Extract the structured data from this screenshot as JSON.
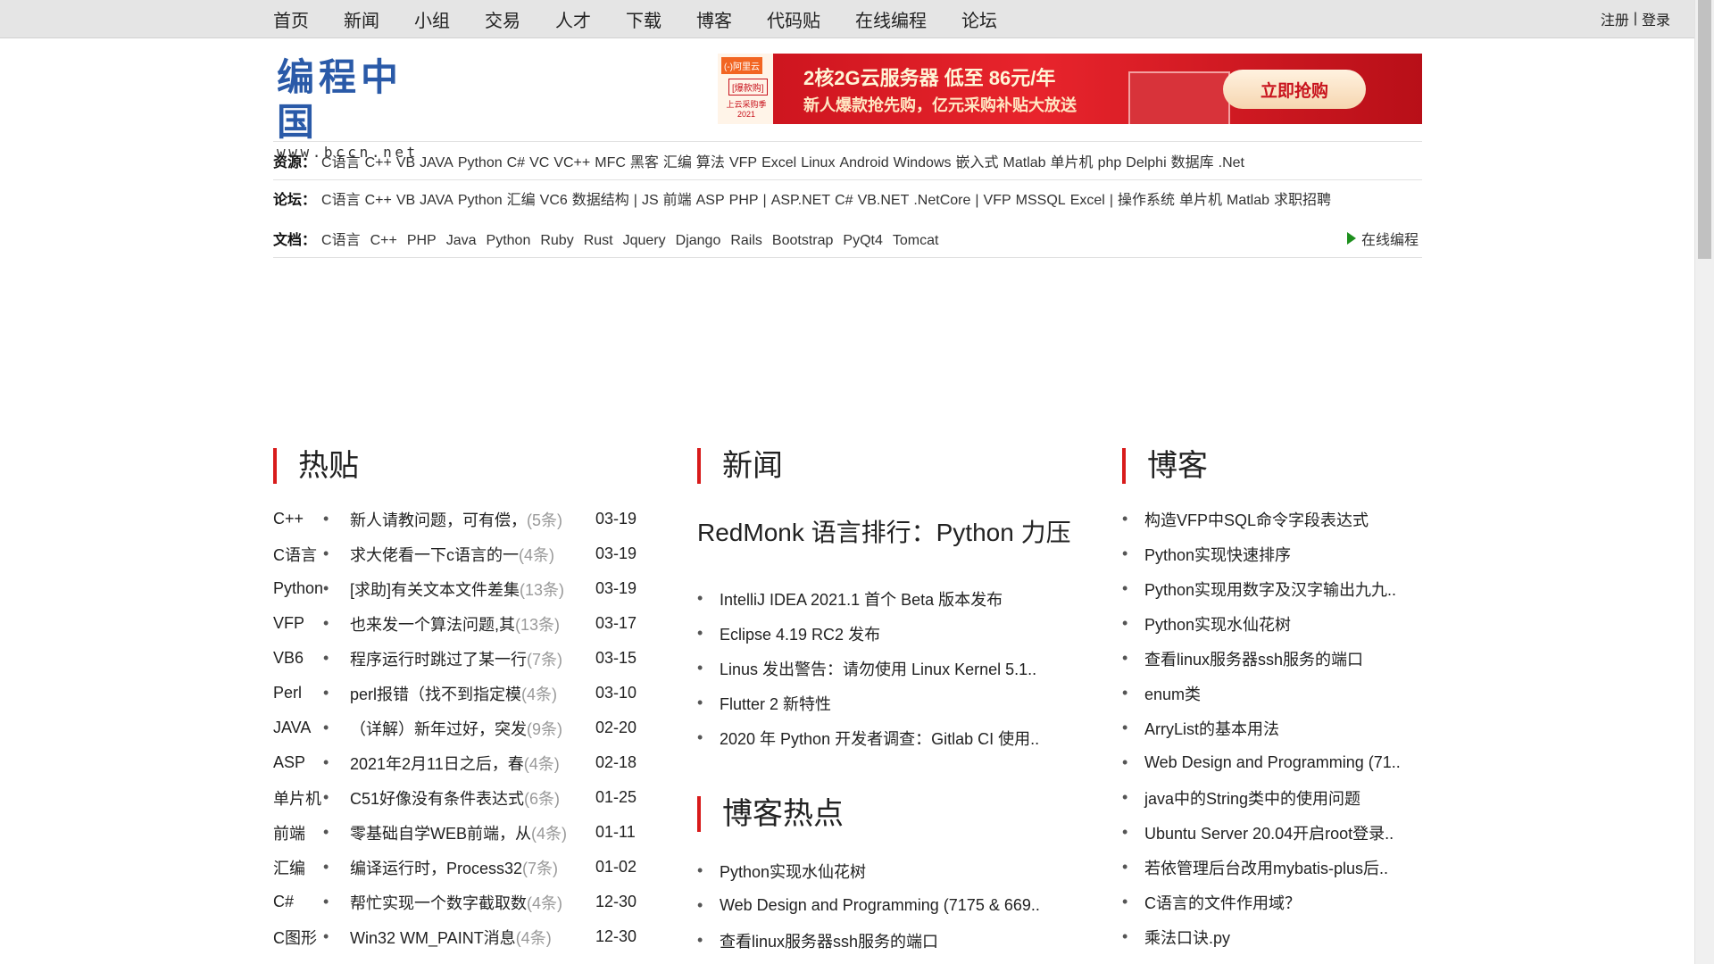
{
  "nav": {
    "items": [
      "首页",
      "新闻",
      "小组",
      "交易",
      "人才",
      "下载",
      "博客",
      "代码贴",
      "在线编程",
      "论坛"
    ],
    "register": "注册",
    "separator": "|",
    "login": "登录"
  },
  "logo": {
    "title": "编程中国",
    "url": "www.bccn.net"
  },
  "ad": {
    "brand": "(-)阿里云",
    "tag": "[爆款购]",
    "sub": "上云采购季 2021",
    "line1": "2核2G云服务器 低至 86元/年",
    "line2": "新人爆款抢先购，亿元采购补贴大放送",
    "button": "立即抢购"
  },
  "resources": {
    "label": "资源：",
    "items": [
      "C语言",
      "C++",
      "VB",
      "JAVA",
      "Python",
      "C#",
      "VC",
      "VC++",
      "MFC",
      "黑客",
      "汇编",
      "算法",
      "VFP",
      "Excel",
      "Linux",
      "Android",
      "Windows",
      "嵌入式",
      "Matlab",
      "单片机",
      "php",
      "Delphi",
      "数据库",
      ".Net"
    ]
  },
  "forums": {
    "label": "论坛：",
    "groups": [
      [
        "C语言",
        "C++",
        "VB",
        "JAVA",
        "Python",
        "汇编",
        "VC6",
        "数据结构"
      ],
      [
        "JS",
        "前端",
        "ASP",
        "PHP"
      ],
      [
        "ASP.NET",
        "C#",
        "VB.NET",
        ".NetCore"
      ],
      [
        "VFP",
        "MSSQL",
        "Excel"
      ],
      [
        "操作系统",
        "单片机",
        "Matlab",
        "求职招聘"
      ]
    ]
  },
  "docs": {
    "label": "文档：",
    "items": [
      "C语言",
      "C++",
      "PHP",
      "Java",
      "Python",
      "Ruby",
      "Rust",
      "Jquery",
      "Django",
      "Rails",
      "Bootstrap",
      "PyQt4",
      "Tomcat"
    ],
    "online": "在线编程"
  },
  "hot": {
    "title": "热贴",
    "bullet": "•",
    "items": [
      {
        "cat": "C++",
        "title": "新人请教问题，可有偿，",
        "count": "(5条)",
        "date": "03-19"
      },
      {
        "cat": "C语言",
        "title": "求大佬看一下c语言的一",
        "count": "(4条)",
        "date": "03-19"
      },
      {
        "cat": "Python",
        "title": "[求助]有关文本文件差集",
        "count": "(13条)",
        "date": "03-19"
      },
      {
        "cat": "VFP",
        "title": "也来发一个算法问题,其",
        "count": "(13条)",
        "date": "03-17"
      },
      {
        "cat": "VB6",
        "title": "程序运行时跳过了某一行",
        "count": "(7条)",
        "date": "03-15"
      },
      {
        "cat": "Perl",
        "title": "perl报错（找不到指定模",
        "count": "(4条)",
        "date": "03-10"
      },
      {
        "cat": "JAVA",
        "title": "（详解）新年过好，突发",
        "count": "(9条)",
        "date": "02-20"
      },
      {
        "cat": "ASP",
        "title": "2021年2月11日之后，春",
        "count": "(4条)",
        "date": "02-18"
      },
      {
        "cat": "单片机",
        "title": "C51好像没有条件表达式",
        "count": "(6条)",
        "date": "01-25"
      },
      {
        "cat": "前端",
        "title": "零基础自学WEB前端，从",
        "count": "(4条)",
        "date": "01-11"
      },
      {
        "cat": "汇编",
        "title": "编译运行时，Process32",
        "count": "(7条)",
        "date": "01-02"
      },
      {
        "cat": "C#",
        "title": "帮忙实现一个数字截取数",
        "count": "(4条)",
        "date": "12-30"
      },
      {
        "cat": "C图形",
        "title": "Win32 WM_PAINT消息",
        "count": "(4条)",
        "date": "12-30"
      }
    ]
  },
  "news": {
    "title": "新闻",
    "headline": "RedMonk 语言排行：Python 力压",
    "items": [
      "IntelliJ IDEA 2021.1 首个 Beta 版本发布",
      "Eclipse 4.19 RC2 发布",
      "Linus 发出警告：请勿使用 Linux Kernel 5.1..",
      "Flutter 2 新特性",
      "2020 年 Python 开发者调查：Gitlab CI 使用.."
    ]
  },
  "bloghot": {
    "title": "博客热点",
    "items": [
      "Python实现水仙花树",
      "Web Design and Programming (7175 & 669..",
      "查看linux服务器ssh服务的端口"
    ]
  },
  "blog": {
    "title": "博客",
    "items": [
      "构造VFP中SQL命令字段表达式",
      "Python实现快速排序",
      "Python实现用数字及汉字输出九九..",
      "Python实现水仙花树",
      "查看linux服务器ssh服务的端口",
      "enum类",
      "ArryList的基本用法",
      "Web Design and Programming (71..",
      "java中的String类中的使用问题",
      "Ubuntu Server 20.04开启root登录..",
      "若依管理后台改用mybatis-plus后..",
      "C语言的文件作用域？",
      "乘法口诀.py"
    ]
  },
  "colors": {
    "accent": "#d81b1b",
    "logo": "#2a5aa8",
    "link_green": "#1d8f1d"
  }
}
